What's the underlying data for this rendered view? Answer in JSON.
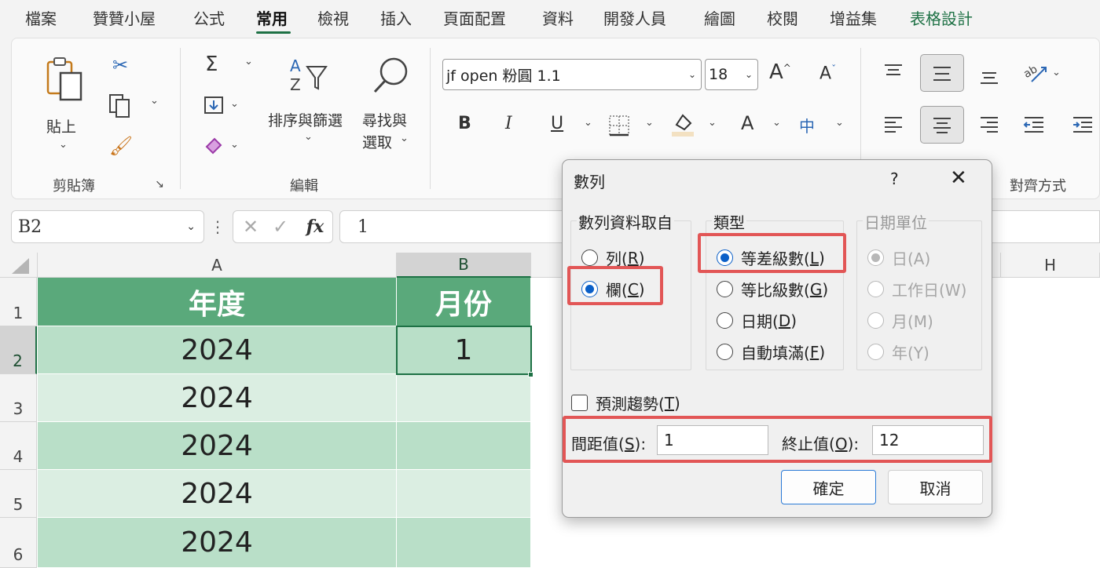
{
  "tabs": [
    {
      "label": "檔案"
    },
    {
      "label": "贊贊小屋"
    },
    {
      "label": "公式"
    },
    {
      "label": "常用"
    },
    {
      "label": "檢視"
    },
    {
      "label": "插入"
    },
    {
      "label": "頁面配置"
    },
    {
      "label": "資料"
    },
    {
      "label": "開發人員"
    },
    {
      "label": "繪圖"
    },
    {
      "label": "校閱"
    },
    {
      "label": "增益集"
    },
    {
      "label": "表格設計"
    }
  ],
  "active_tab": "常用",
  "ribbon": {
    "clipboard": {
      "paste_label": "貼上",
      "group_label": "剪貼簿"
    },
    "editing": {
      "sum_symbol": "Σ",
      "sort_label": "排序與篩選",
      "find_label_1": "尋找與",
      "find_label_2": "選取",
      "group_label": "編輯"
    },
    "font": {
      "font_name": "jf open 粉圓 1.1",
      "font_size": "18",
      "bold": "B",
      "italic": "I",
      "underline": "U",
      "font_color_glyph": "A",
      "phonetic_glyph": "中"
    },
    "alignment": {
      "group_label": "對齊方式"
    }
  },
  "formula_bar": {
    "name_box": "B2",
    "fx": "fx",
    "value": "1"
  },
  "sheet": {
    "columns": [
      "A",
      "B",
      "H"
    ],
    "rows": [
      "1",
      "2",
      "3",
      "4",
      "5",
      "6"
    ],
    "header": {
      "a": "年度",
      "b": "月份"
    },
    "data": [
      {
        "a": "2024",
        "b": "1"
      },
      {
        "a": "2024",
        "b": ""
      },
      {
        "a": "2024",
        "b": ""
      },
      {
        "a": "2024",
        "b": ""
      },
      {
        "a": "2024",
        "b": ""
      }
    ]
  },
  "dialog": {
    "title": "數列",
    "help": "?",
    "close": "✕",
    "series_in": {
      "title": "數列資料取自",
      "options": [
        {
          "label": "列(",
          "key": "R",
          "selected": false
        },
        {
          "label": "欄(",
          "key": "C",
          "selected": true
        }
      ]
    },
    "type": {
      "title": "類型",
      "options": [
        {
          "label": "等差級數(",
          "key": "L",
          "selected": true
        },
        {
          "label": "等比級數(",
          "key": "G",
          "selected": false
        },
        {
          "label": "日期(",
          "key": "D",
          "selected": false
        },
        {
          "label": "自動填滿(",
          "key": "F",
          "selected": false
        }
      ]
    },
    "date_unit": {
      "title": "日期單位",
      "options": [
        {
          "label": "日(A)",
          "selected": true
        },
        {
          "label": "工作日(W)",
          "selected": false
        },
        {
          "label": "月(M)",
          "selected": false
        },
        {
          "label": "年(Y)",
          "selected": false
        }
      ]
    },
    "trend": {
      "label": "預測趨勢(",
      "key": "T",
      "checked": false
    },
    "step": {
      "label": "間距值(",
      "key": "S",
      "value": "1"
    },
    "stop": {
      "label": "終止值(",
      "key": "O",
      "value": "12"
    },
    "ok_label": "確定",
    "cancel_label": "取消"
  },
  "colors": {
    "accent": "#1e7145",
    "header_fill": "#5aa97b",
    "band1": "#b9dfc8",
    "band2": "#dbeee2",
    "highlight": "#e25656",
    "radio": "#0a5fc8"
  }
}
